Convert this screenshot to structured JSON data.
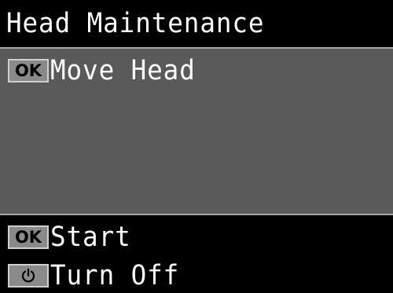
{
  "title": "Head Maintenance",
  "content": {
    "items": [
      {
        "key": "OK",
        "label": "Move Head"
      }
    ]
  },
  "footer": {
    "start": {
      "key": "OK",
      "label": "Start"
    },
    "turn_off": {
      "key_icon": "power-icon",
      "label": "Turn Off"
    }
  },
  "colors": {
    "background": "#000000",
    "content_background": "#5a5a5a",
    "badge_background": "#8a8a8a",
    "text": "#ffffff"
  }
}
